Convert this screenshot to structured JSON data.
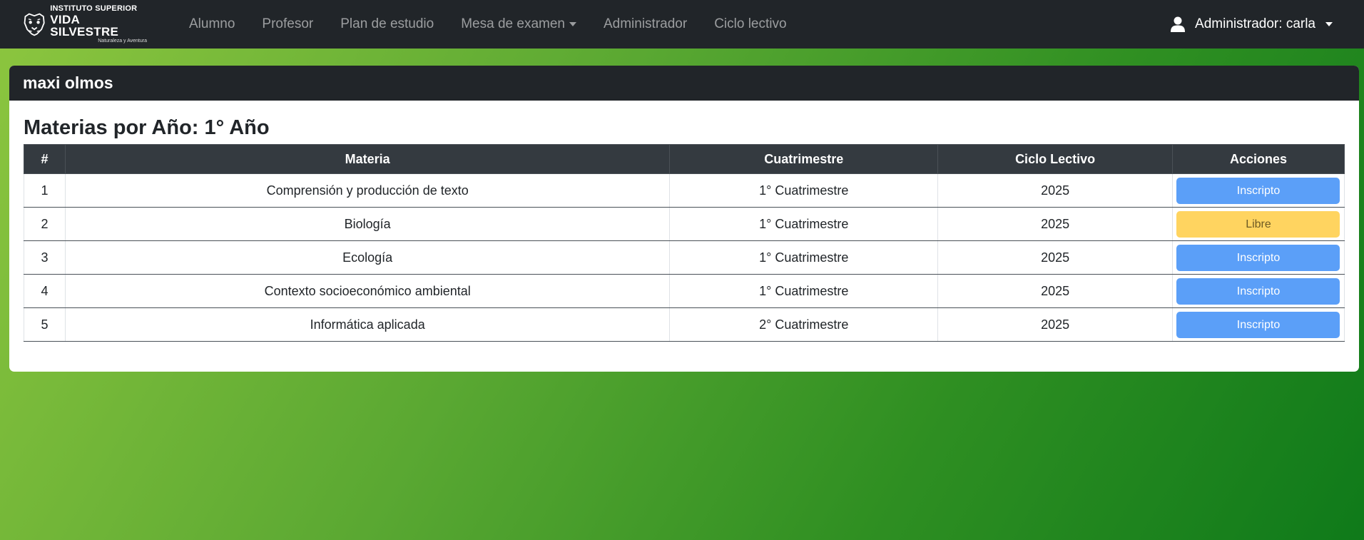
{
  "brand": {
    "line1": "INSTITUTO SUPERIOR",
    "line2": "VIDA SILVESTRE",
    "line3": "Naturaleza y Aventura",
    "logo_icon": "jaguar-head-icon"
  },
  "nav": {
    "items": [
      {
        "label": "Alumno",
        "dropdown": false
      },
      {
        "label": "Profesor",
        "dropdown": false
      },
      {
        "label": "Plan de estudio",
        "dropdown": false
      },
      {
        "label": "Mesa de examen",
        "dropdown": true
      },
      {
        "label": "Administrador",
        "dropdown": false
      },
      {
        "label": "Ciclo lectivo",
        "dropdown": false
      }
    ],
    "user_label": "Administrador: carla",
    "user_icon": "user-icon"
  },
  "card": {
    "header": "maxi olmos",
    "title": "Materias por Año: 1° Año"
  },
  "table": {
    "columns": [
      "#",
      "Materia",
      "Cuatrimestre",
      "Ciclo Lectivo",
      "Acciones"
    ],
    "rows": [
      {
        "num": "1",
        "materia": "Comprensión y producción de texto",
        "cuatrimestre": "1° Cuatrimestre",
        "ciclo": "2025",
        "accion": "Inscripto"
      },
      {
        "num": "2",
        "materia": "Biología",
        "cuatrimestre": "1° Cuatrimestre",
        "ciclo": "2025",
        "accion": "Libre"
      },
      {
        "num": "3",
        "materia": "Ecología",
        "cuatrimestre": "1° Cuatrimestre",
        "ciclo": "2025",
        "accion": "Inscripto"
      },
      {
        "num": "4",
        "materia": "Contexto socioeconómico ambiental",
        "cuatrimestre": "1° Cuatrimestre",
        "ciclo": "2025",
        "accion": "Inscripto"
      },
      {
        "num": "5",
        "materia": "Informática aplicada",
        "cuatrimestre": "2° Cuatrimestre",
        "ciclo": "2025",
        "accion": "Inscripto"
      }
    ]
  },
  "colors": {
    "navbar": "#212529",
    "inscripto": "#5b9ff8",
    "libre": "#ffd460",
    "gradient_start": "#8dc63f",
    "gradient_end": "#0f7a1a"
  }
}
